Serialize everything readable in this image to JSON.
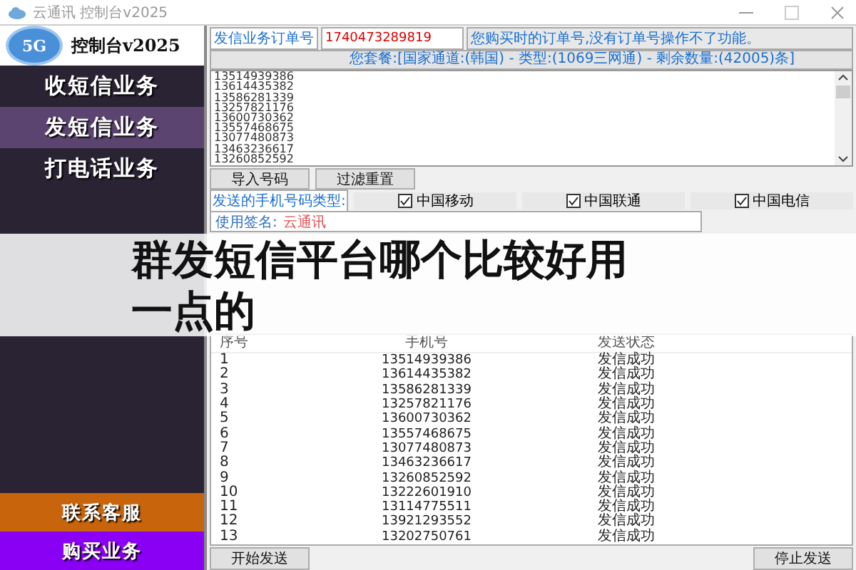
{
  "window": {
    "title": "云通讯 控制台v2025"
  },
  "sidebar": {
    "logo_badge": "5G",
    "logo_text": "控制台v2025",
    "items": [
      {
        "label": "收短信业务",
        "selected": false
      },
      {
        "label": "发短信业务",
        "selected": true
      },
      {
        "label": "打电话业务",
        "selected": false
      }
    ],
    "bottom_items": [
      {
        "label": "联系客服",
        "color": "#c8650c"
      },
      {
        "label": "购买业务",
        "color": "#8a00f5"
      }
    ]
  },
  "order": {
    "label": "发信业务订单号",
    "value": "1740473289819",
    "hint": "您购买时的订单号,没有订单号操作不了功能。"
  },
  "package_info": "您套餐:[国家通道:(韩国) - 类型:(1069三网通) - 剩余数量:(42005)条]",
  "numbers": [
    "13514939386",
    "13614435382",
    "13586281339",
    "13257821176",
    "13600730362",
    "13557468675",
    "13077480873",
    "13463236617",
    "13260852592"
  ],
  "import_button": "导入号码",
  "reset_button": "过滤重置",
  "carrier_label": "发送的手机号码类型:",
  "carriers": [
    {
      "label": "中国移动",
      "checked": true
    },
    {
      "label": "中国联通",
      "checked": true
    },
    {
      "label": "中国电信",
      "checked": true
    }
  ],
  "signature": {
    "label": "使用签名:",
    "value": "云通讯"
  },
  "table": {
    "columns": [
      "序号",
      "手机号",
      "发送状态"
    ],
    "rows": [
      {
        "index": "1",
        "phone": "13514939386",
        "status": "发信成功"
      },
      {
        "index": "2",
        "phone": "13614435382",
        "status": "发信成功"
      },
      {
        "index": "3",
        "phone": "13586281339",
        "status": "发信成功"
      },
      {
        "index": "4",
        "phone": "13257821176",
        "status": "发信成功"
      },
      {
        "index": "5",
        "phone": "13600730362",
        "status": "发信成功"
      },
      {
        "index": "6",
        "phone": "13557468675",
        "status": "发信成功"
      },
      {
        "index": "7",
        "phone": "13077480873",
        "status": "发信成功"
      },
      {
        "index": "8",
        "phone": "13463236617",
        "status": "发信成功"
      },
      {
        "index": "9",
        "phone": "13260852592",
        "status": "发信成功"
      },
      {
        "index": "10",
        "phone": "13222601910",
        "status": "发信成功"
      },
      {
        "index": "11",
        "phone": "13114775511",
        "status": "发信成功"
      },
      {
        "index": "12",
        "phone": "13921293552",
        "status": "发信成功"
      },
      {
        "index": "13",
        "phone": "13202750761",
        "status": "发信成功"
      }
    ]
  },
  "start_button": "开始发送",
  "stop_button": "停止发送",
  "overlay_title": "群发短信平台哪个比较好用一点的"
}
